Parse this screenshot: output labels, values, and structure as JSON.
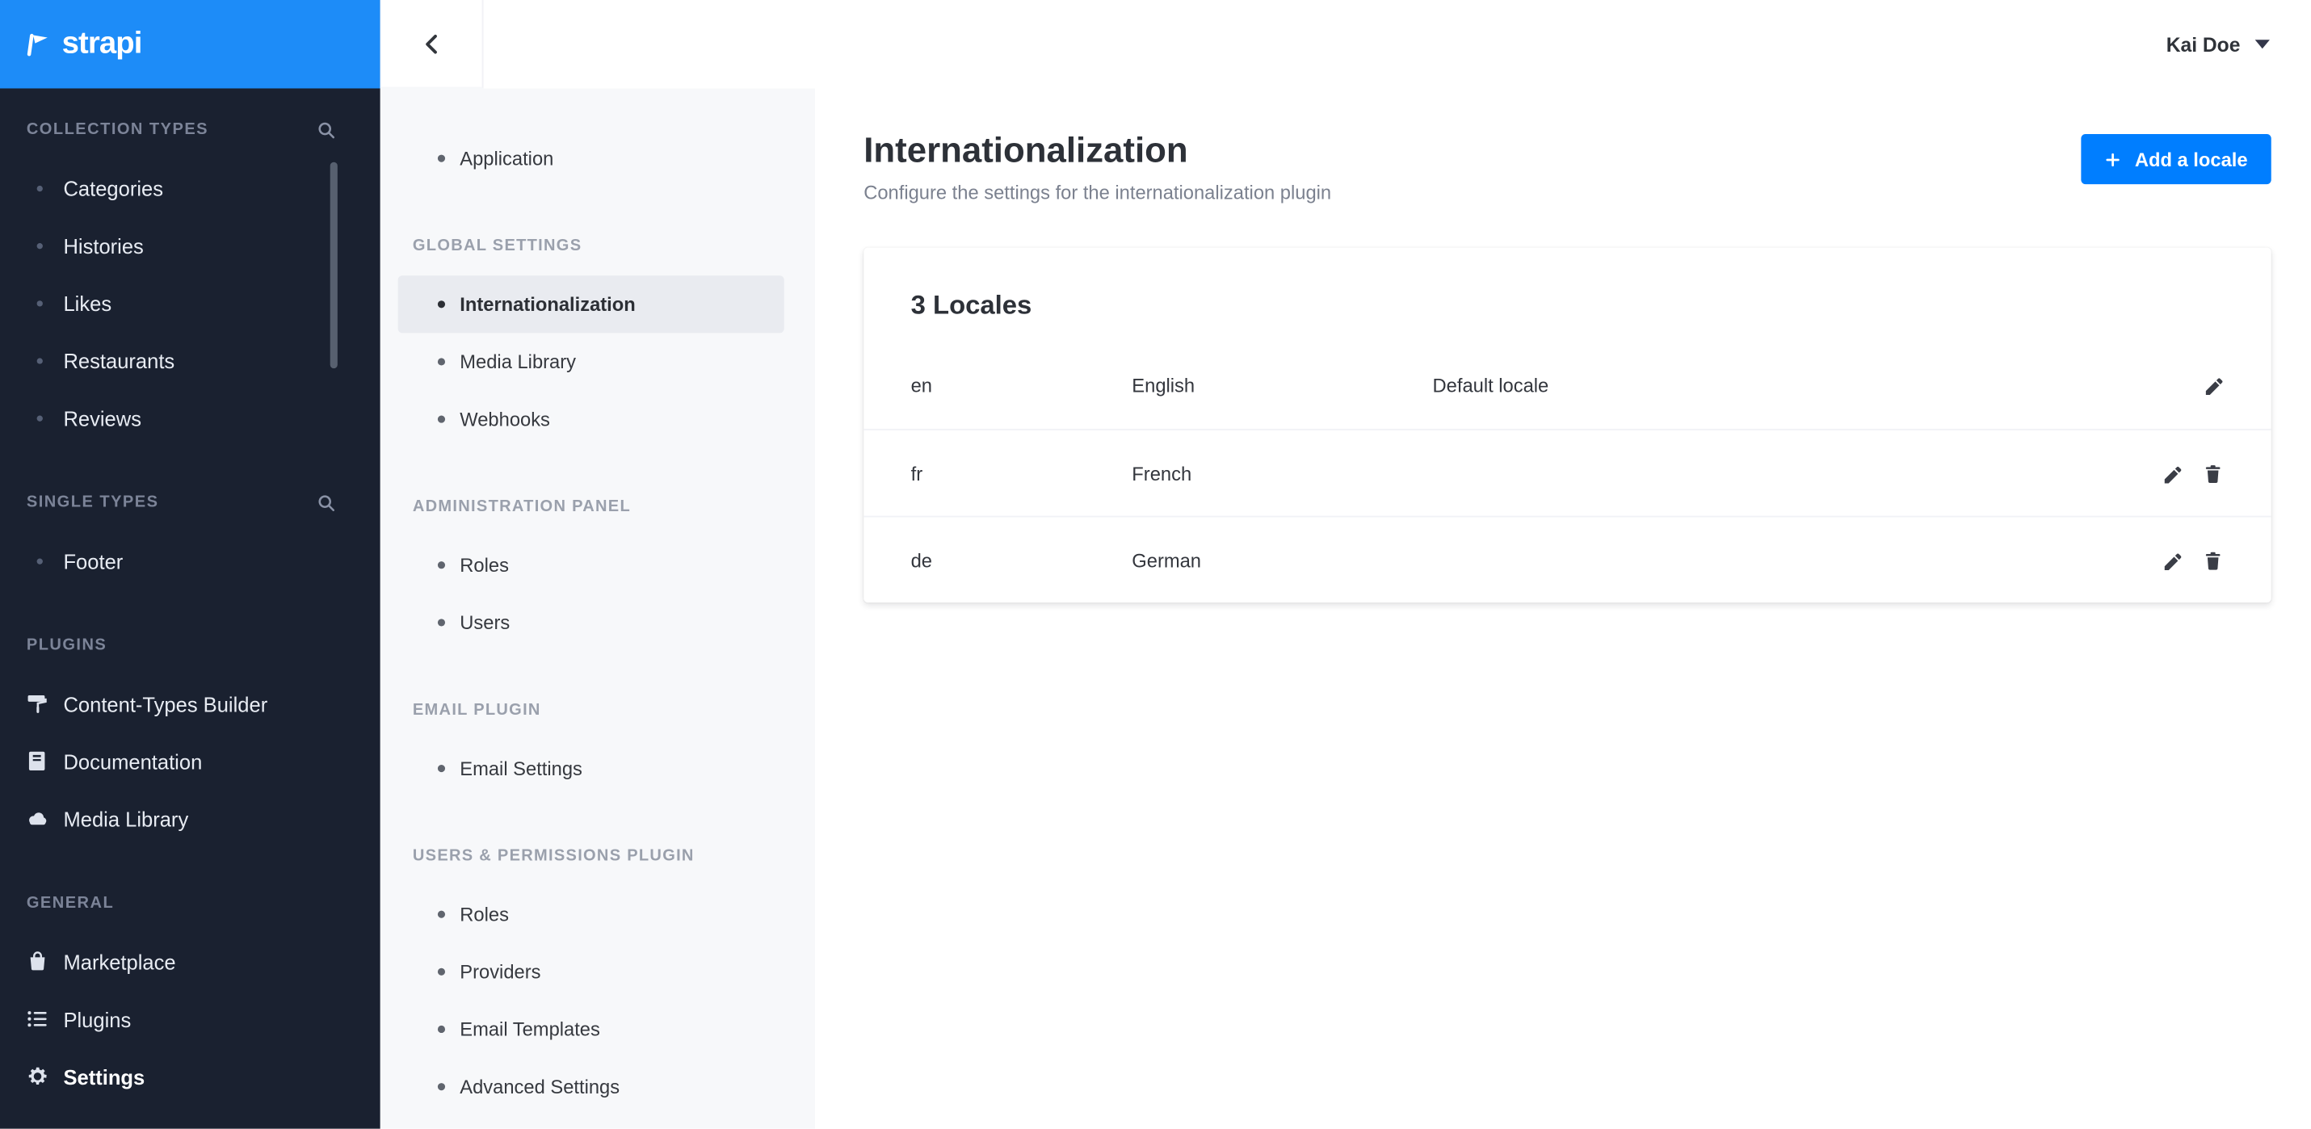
{
  "colors": {
    "primary_blue": "#007eff",
    "logo_blue": "#1d8cf8",
    "sidebar_dark": "#1a2130",
    "subnav_gray": "#f7f8fa"
  },
  "brand": {
    "name": "strapi"
  },
  "topbar": {
    "user_name": "Kai Doe",
    "back_icon": "chevron-left-icon",
    "user_caret_icon": "chevron-down-icon"
  },
  "main_nav": {
    "sections": [
      {
        "title": "COLLECTION TYPES",
        "search_icon": "search-icon",
        "items": [
          {
            "label": "Categories"
          },
          {
            "label": "Histories"
          },
          {
            "label": "Likes"
          },
          {
            "label": "Restaurants"
          },
          {
            "label": "Reviews"
          }
        ]
      },
      {
        "title": "SINGLE TYPES",
        "search_icon": "search-icon",
        "items": [
          {
            "label": "Footer"
          }
        ]
      },
      {
        "title": "PLUGINS",
        "items": [
          {
            "label": "Content-Types Builder",
            "icon": "roller-icon"
          },
          {
            "label": "Documentation",
            "icon": "book-icon"
          },
          {
            "label": "Media Library",
            "icon": "cloud-icon"
          }
        ]
      },
      {
        "title": "GENERAL",
        "items": [
          {
            "label": "Marketplace",
            "icon": "bag-icon"
          },
          {
            "label": "Plugins",
            "icon": "list-icon"
          },
          {
            "label": "Settings",
            "icon": "gear-icon",
            "active": true
          }
        ]
      }
    ]
  },
  "settings_nav": {
    "top_item": {
      "label": "Application"
    },
    "sections": [
      {
        "title": "GLOBAL SETTINGS",
        "items": [
          {
            "label": "Internationalization",
            "active": true
          },
          {
            "label": "Media Library"
          },
          {
            "label": "Webhooks"
          }
        ]
      },
      {
        "title": "ADMINISTRATION PANEL",
        "items": [
          {
            "label": "Roles"
          },
          {
            "label": "Users"
          }
        ]
      },
      {
        "title": "EMAIL PLUGIN",
        "items": [
          {
            "label": "Email Settings"
          }
        ]
      },
      {
        "title": "USERS & PERMISSIONS PLUGIN",
        "items": [
          {
            "label": "Roles"
          },
          {
            "label": "Providers"
          },
          {
            "label": "Email Templates"
          },
          {
            "label": "Advanced Settings"
          }
        ]
      }
    ]
  },
  "page": {
    "title": "Internationalization",
    "subtitle": "Configure the settings for the internationalization plugin",
    "add_button_label": "Add a locale",
    "add_button_icon": "plus-icon"
  },
  "locales_card": {
    "title": "3 Locales",
    "rows": [
      {
        "code": "en",
        "name": "English",
        "note": "Default locale",
        "actions": [
          "edit"
        ]
      },
      {
        "code": "fr",
        "name": "French",
        "note": "",
        "actions": [
          "edit",
          "delete"
        ]
      },
      {
        "code": "de",
        "name": "German",
        "note": "",
        "actions": [
          "edit",
          "delete"
        ]
      }
    ]
  }
}
